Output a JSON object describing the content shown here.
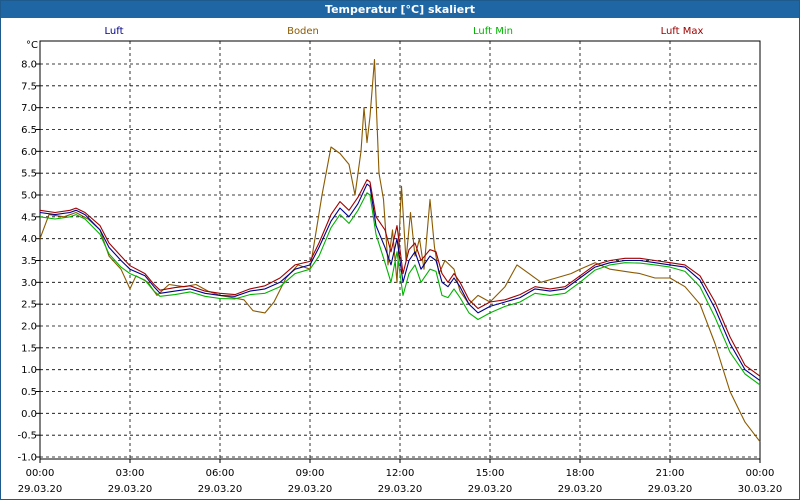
{
  "window": {
    "title": "Temperatur [°C] skaliert"
  },
  "colors": {
    "titlebar": "#1f66a5",
    "luft": "#00008b",
    "boden": "#8b5a00",
    "luft_min": "#00b400",
    "luft_max": "#a00000",
    "grid": "#000000"
  },
  "chart_data": {
    "type": "line",
    "title": "Temperatur [°C] skaliert",
    "ylabel": "°C",
    "ylim": [
      -1.0,
      8.0
    ],
    "yticks": [
      "8.0",
      "7.5",
      "7.0",
      "6.5",
      "6.0",
      "5.5",
      "5.0",
      "4.5",
      "4.0",
      "3.5",
      "3.0",
      "2.5",
      "2.0",
      "1.5",
      "1.0",
      "0.5",
      "0.0",
      "-0.5",
      "-1.0"
    ],
    "x_ticks": [
      {
        "h": 0,
        "time": "00:00",
        "date": "29.03.20"
      },
      {
        "h": 3,
        "time": "03:00",
        "date": "29.03.20"
      },
      {
        "h": 6,
        "time": "06:00",
        "date": "29.03.20"
      },
      {
        "h": 9,
        "time": "09:00",
        "date": "29.03.20"
      },
      {
        "h": 12,
        "time": "12:00",
        "date": "29.03.20"
      },
      {
        "h": 15,
        "time": "15:00",
        "date": "29.03.20"
      },
      {
        "h": 18,
        "time": "18:00",
        "date": "29.03.20"
      },
      {
        "h": 21,
        "time": "21:00",
        "date": "29.03.20"
      },
      {
        "h": 24,
        "time": "00:00",
        "date": "30.03.20"
      }
    ],
    "legend_position": "top",
    "grid": true,
    "series": [
      {
        "name": "Luft",
        "color": "#00008b",
        "points": [
          [
            0,
            4.6
          ],
          [
            0.5,
            4.55
          ],
          [
            1.0,
            4.6
          ],
          [
            1.2,
            4.65
          ],
          [
            1.5,
            4.55
          ],
          [
            2.0,
            4.2
          ],
          [
            2.3,
            3.8
          ],
          [
            2.7,
            3.5
          ],
          [
            3.0,
            3.3
          ],
          [
            3.5,
            3.15
          ],
          [
            3.8,
            2.9
          ],
          [
            4.0,
            2.75
          ],
          [
            4.5,
            2.8
          ],
          [
            5.0,
            2.85
          ],
          [
            5.5,
            2.75
          ],
          [
            6.0,
            2.7
          ],
          [
            6.5,
            2.68
          ],
          [
            7.0,
            2.8
          ],
          [
            7.5,
            2.85
          ],
          [
            8.0,
            3.0
          ],
          [
            8.5,
            3.3
          ],
          [
            9.0,
            3.4
          ],
          [
            9.3,
            3.8
          ],
          [
            9.7,
            4.4
          ],
          [
            10.0,
            4.7
          ],
          [
            10.3,
            4.5
          ],
          [
            10.6,
            4.8
          ],
          [
            10.9,
            5.25
          ],
          [
            11.0,
            5.2
          ],
          [
            11.2,
            4.3
          ],
          [
            11.5,
            3.8
          ],
          [
            11.7,
            3.4
          ],
          [
            11.9,
            4.0
          ],
          [
            12.1,
            3.0
          ],
          [
            12.3,
            3.5
          ],
          [
            12.5,
            3.7
          ],
          [
            12.7,
            3.3
          ],
          [
            13.0,
            3.6
          ],
          [
            13.2,
            3.5
          ],
          [
            13.4,
            3.0
          ],
          [
            13.6,
            2.9
          ],
          [
            13.8,
            3.1
          ],
          [
            14.0,
            2.9
          ],
          [
            14.3,
            2.5
          ],
          [
            14.6,
            2.3
          ],
          [
            15.0,
            2.45
          ],
          [
            15.5,
            2.55
          ],
          [
            16.0,
            2.65
          ],
          [
            16.5,
            2.85
          ],
          [
            17.0,
            2.8
          ],
          [
            17.5,
            2.85
          ],
          [
            18.0,
            3.1
          ],
          [
            18.5,
            3.35
          ],
          [
            19.0,
            3.45
          ],
          [
            19.5,
            3.5
          ],
          [
            20.0,
            3.5
          ],
          [
            20.5,
            3.45
          ],
          [
            21.0,
            3.4
          ],
          [
            21.5,
            3.35
          ],
          [
            22.0,
            3.05
          ],
          [
            22.5,
            2.4
          ],
          [
            23.0,
            1.6
          ],
          [
            23.5,
            1.0
          ],
          [
            24.0,
            0.75
          ]
        ]
      },
      {
        "name": "Boden",
        "color": "#8b5a00",
        "points": [
          [
            0,
            4.0
          ],
          [
            0.3,
            4.55
          ],
          [
            0.8,
            4.5
          ],
          [
            1.2,
            4.6
          ],
          [
            1.6,
            4.45
          ],
          [
            2.0,
            4.2
          ],
          [
            2.3,
            3.6
          ],
          [
            2.7,
            3.3
          ],
          [
            3.0,
            2.85
          ],
          [
            3.2,
            3.15
          ],
          [
            3.6,
            3.0
          ],
          [
            3.9,
            2.7
          ],
          [
            4.3,
            2.95
          ],
          [
            4.8,
            2.9
          ],
          [
            5.2,
            2.95
          ],
          [
            5.6,
            2.8
          ],
          [
            6.0,
            2.7
          ],
          [
            6.4,
            2.65
          ],
          [
            6.8,
            2.6
          ],
          [
            7.1,
            2.35
          ],
          [
            7.5,
            2.3
          ],
          [
            7.8,
            2.55
          ],
          [
            8.2,
            3.1
          ],
          [
            8.6,
            3.4
          ],
          [
            9.0,
            3.3
          ],
          [
            9.4,
            5.0
          ],
          [
            9.7,
            6.1
          ],
          [
            10.0,
            5.95
          ],
          [
            10.3,
            5.7
          ],
          [
            10.5,
            5.0
          ],
          [
            10.7,
            6.0
          ],
          [
            10.8,
            7.0
          ],
          [
            10.9,
            6.2
          ],
          [
            11.0,
            6.8
          ],
          [
            11.15,
            8.1
          ],
          [
            11.3,
            5.5
          ],
          [
            11.45,
            4.9
          ],
          [
            11.6,
            3.4
          ],
          [
            11.75,
            4.2
          ],
          [
            11.9,
            3.0
          ],
          [
            12.05,
            5.2
          ],
          [
            12.2,
            3.5
          ],
          [
            12.35,
            4.6
          ],
          [
            12.5,
            3.6
          ],
          [
            12.65,
            4.0
          ],
          [
            12.8,
            3.3
          ],
          [
            13.0,
            4.9
          ],
          [
            13.15,
            3.8
          ],
          [
            13.3,
            3.2
          ],
          [
            13.5,
            3.5
          ],
          [
            13.8,
            3.3
          ],
          [
            14.0,
            2.8
          ],
          [
            14.3,
            2.5
          ],
          [
            14.6,
            2.7
          ],
          [
            15.0,
            2.55
          ],
          [
            15.5,
            2.9
          ],
          [
            15.9,
            3.4
          ],
          [
            16.3,
            3.2
          ],
          [
            16.7,
            3.0
          ],
          [
            17.2,
            3.1
          ],
          [
            17.7,
            3.2
          ],
          [
            18.0,
            3.3
          ],
          [
            18.5,
            3.45
          ],
          [
            19.0,
            3.3
          ],
          [
            19.5,
            3.25
          ],
          [
            20.0,
            3.2
          ],
          [
            20.5,
            3.1
          ],
          [
            21.0,
            3.1
          ],
          [
            21.5,
            2.9
          ],
          [
            22.0,
            2.5
          ],
          [
            22.5,
            1.6
          ],
          [
            23.0,
            0.5
          ],
          [
            23.5,
            -0.2
          ],
          [
            24.0,
            -0.65
          ]
        ]
      },
      {
        "name": "Luft Min",
        "color": "#00b400",
        "points": [
          [
            0,
            4.5
          ],
          [
            0.5,
            4.45
          ],
          [
            1.0,
            4.5
          ],
          [
            1.2,
            4.55
          ],
          [
            1.5,
            4.45
          ],
          [
            2.0,
            4.1
          ],
          [
            2.3,
            3.65
          ],
          [
            2.7,
            3.35
          ],
          [
            3.0,
            3.2
          ],
          [
            3.5,
            3.05
          ],
          [
            3.8,
            2.8
          ],
          [
            4.0,
            2.68
          ],
          [
            4.5,
            2.72
          ],
          [
            5.0,
            2.78
          ],
          [
            5.5,
            2.68
          ],
          [
            6.0,
            2.63
          ],
          [
            6.5,
            2.62
          ],
          [
            7.0,
            2.72
          ],
          [
            7.5,
            2.75
          ],
          [
            8.0,
            2.9
          ],
          [
            8.5,
            3.2
          ],
          [
            9.0,
            3.3
          ],
          [
            9.3,
            3.6
          ],
          [
            9.7,
            4.25
          ],
          [
            10.0,
            4.55
          ],
          [
            10.3,
            4.35
          ],
          [
            10.6,
            4.65
          ],
          [
            10.9,
            5.05
          ],
          [
            11.0,
            5.0
          ],
          [
            11.2,
            4.1
          ],
          [
            11.5,
            3.45
          ],
          [
            11.7,
            3.0
          ],
          [
            11.9,
            3.7
          ],
          [
            12.1,
            2.7
          ],
          [
            12.3,
            3.2
          ],
          [
            12.5,
            3.4
          ],
          [
            12.7,
            3.0
          ],
          [
            13.0,
            3.3
          ],
          [
            13.2,
            3.25
          ],
          [
            13.4,
            2.7
          ],
          [
            13.6,
            2.65
          ],
          [
            13.8,
            2.85
          ],
          [
            14.0,
            2.65
          ],
          [
            14.3,
            2.3
          ],
          [
            14.6,
            2.15
          ],
          [
            15.0,
            2.3
          ],
          [
            15.5,
            2.45
          ],
          [
            16.0,
            2.55
          ],
          [
            16.5,
            2.75
          ],
          [
            17.0,
            2.7
          ],
          [
            17.5,
            2.75
          ],
          [
            18.0,
            3.0
          ],
          [
            18.5,
            3.28
          ],
          [
            19.0,
            3.4
          ],
          [
            19.5,
            3.45
          ],
          [
            20.0,
            3.44
          ],
          [
            20.5,
            3.4
          ],
          [
            21.0,
            3.35
          ],
          [
            21.5,
            3.25
          ],
          [
            22.0,
            2.9
          ],
          [
            22.5,
            2.2
          ],
          [
            23.0,
            1.4
          ],
          [
            23.5,
            0.9
          ],
          [
            24.0,
            0.65
          ]
        ]
      },
      {
        "name": "Luft Max",
        "color": "#a00000",
        "points": [
          [
            0,
            4.65
          ],
          [
            0.5,
            4.6
          ],
          [
            1.0,
            4.65
          ],
          [
            1.2,
            4.7
          ],
          [
            1.5,
            4.6
          ],
          [
            2.0,
            4.3
          ],
          [
            2.3,
            3.9
          ],
          [
            2.7,
            3.6
          ],
          [
            3.0,
            3.38
          ],
          [
            3.5,
            3.2
          ],
          [
            3.8,
            2.95
          ],
          [
            4.0,
            2.82
          ],
          [
            4.5,
            2.88
          ],
          [
            5.0,
            2.92
          ],
          [
            5.5,
            2.8
          ],
          [
            6.0,
            2.75
          ],
          [
            6.5,
            2.72
          ],
          [
            7.0,
            2.85
          ],
          [
            7.5,
            2.92
          ],
          [
            8.0,
            3.1
          ],
          [
            8.5,
            3.4
          ],
          [
            9.0,
            3.48
          ],
          [
            9.3,
            3.9
          ],
          [
            9.7,
            4.55
          ],
          [
            10.0,
            4.85
          ],
          [
            10.3,
            4.65
          ],
          [
            10.6,
            4.95
          ],
          [
            10.9,
            5.35
          ],
          [
            11.0,
            5.3
          ],
          [
            11.2,
            4.5
          ],
          [
            11.5,
            4.2
          ],
          [
            11.7,
            3.7
          ],
          [
            11.9,
            4.3
          ],
          [
            12.1,
            3.2
          ],
          [
            12.3,
            3.75
          ],
          [
            12.5,
            3.9
          ],
          [
            12.7,
            3.5
          ],
          [
            13.0,
            3.75
          ],
          [
            13.2,
            3.7
          ],
          [
            13.4,
            3.2
          ],
          [
            13.6,
            3.0
          ],
          [
            13.8,
            3.2
          ],
          [
            14.0,
            3.0
          ],
          [
            14.3,
            2.6
          ],
          [
            14.6,
            2.4
          ],
          [
            15.0,
            2.55
          ],
          [
            15.5,
            2.6
          ],
          [
            16.0,
            2.72
          ],
          [
            16.5,
            2.9
          ],
          [
            17.0,
            2.85
          ],
          [
            17.5,
            2.9
          ],
          [
            18.0,
            3.15
          ],
          [
            18.5,
            3.4
          ],
          [
            19.0,
            3.5
          ],
          [
            19.5,
            3.55
          ],
          [
            20.0,
            3.55
          ],
          [
            20.5,
            3.5
          ],
          [
            21.0,
            3.45
          ],
          [
            21.5,
            3.4
          ],
          [
            22.0,
            3.15
          ],
          [
            22.5,
            2.55
          ],
          [
            23.0,
            1.75
          ],
          [
            23.5,
            1.1
          ],
          [
            24.0,
            0.85
          ]
        ]
      }
    ]
  }
}
